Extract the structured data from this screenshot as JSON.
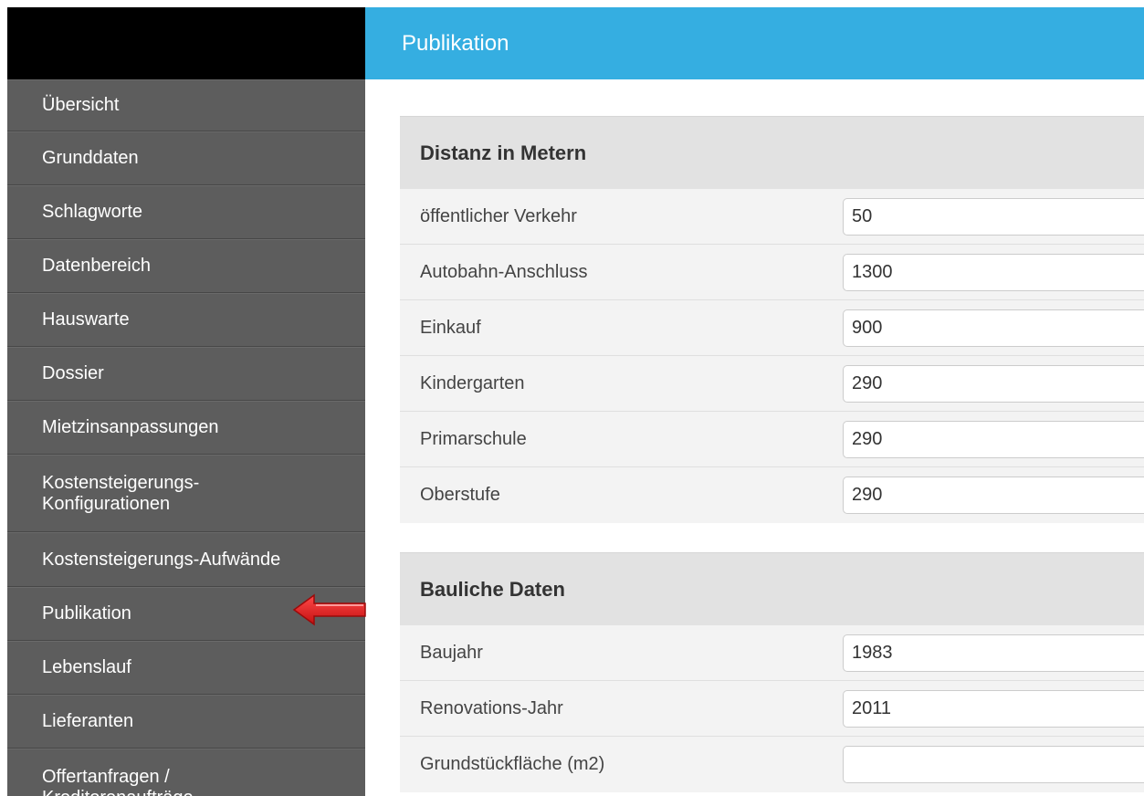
{
  "header": {
    "title": "Publikation"
  },
  "sidebar": {
    "items": [
      {
        "label": "Übersicht"
      },
      {
        "label": "Grunddaten"
      },
      {
        "label": "Schlagworte"
      },
      {
        "label": "Datenbereich"
      },
      {
        "label": "Hauswarte"
      },
      {
        "label": "Dossier"
      },
      {
        "label": "Mietzinsanpassungen"
      },
      {
        "label": "Kostensteigerungs-",
        "label2": "Konfigurationen"
      },
      {
        "label": "Kostensteigerungs-Aufwände"
      },
      {
        "label": "Publikation"
      },
      {
        "label": "Lebenslauf"
      },
      {
        "label": "Lieferanten"
      },
      {
        "label": "Offertanfragen /",
        "label2": "Kreditorenaufträge"
      }
    ]
  },
  "sections": {
    "distanz": {
      "title": "Distanz in Metern",
      "rows": [
        {
          "label": "öffentlicher Verkehr",
          "value": "50"
        },
        {
          "label": "Autobahn-Anschluss",
          "value": "1300"
        },
        {
          "label": "Einkauf",
          "value": "900"
        },
        {
          "label": "Kindergarten",
          "value": "290"
        },
        {
          "label": "Primarschule",
          "value": "290"
        },
        {
          "label": "Oberstufe",
          "value": "290"
        }
      ]
    },
    "bauliche": {
      "title": "Bauliche Daten",
      "rows": [
        {
          "label": "Baujahr",
          "value": "1983"
        },
        {
          "label": "Renovations-Jahr",
          "value": "2011"
        },
        {
          "label": "Grundstückfläche (m2)",
          "value": ""
        }
      ]
    }
  },
  "colors": {
    "header": "#35aee1",
    "sidebar": "#5d5d5d",
    "sidebar_top": "#000000",
    "arrow": "#e52222",
    "section_header": "#e2e2e2"
  },
  "icons": {
    "pointer": "red-arrow-icon"
  }
}
